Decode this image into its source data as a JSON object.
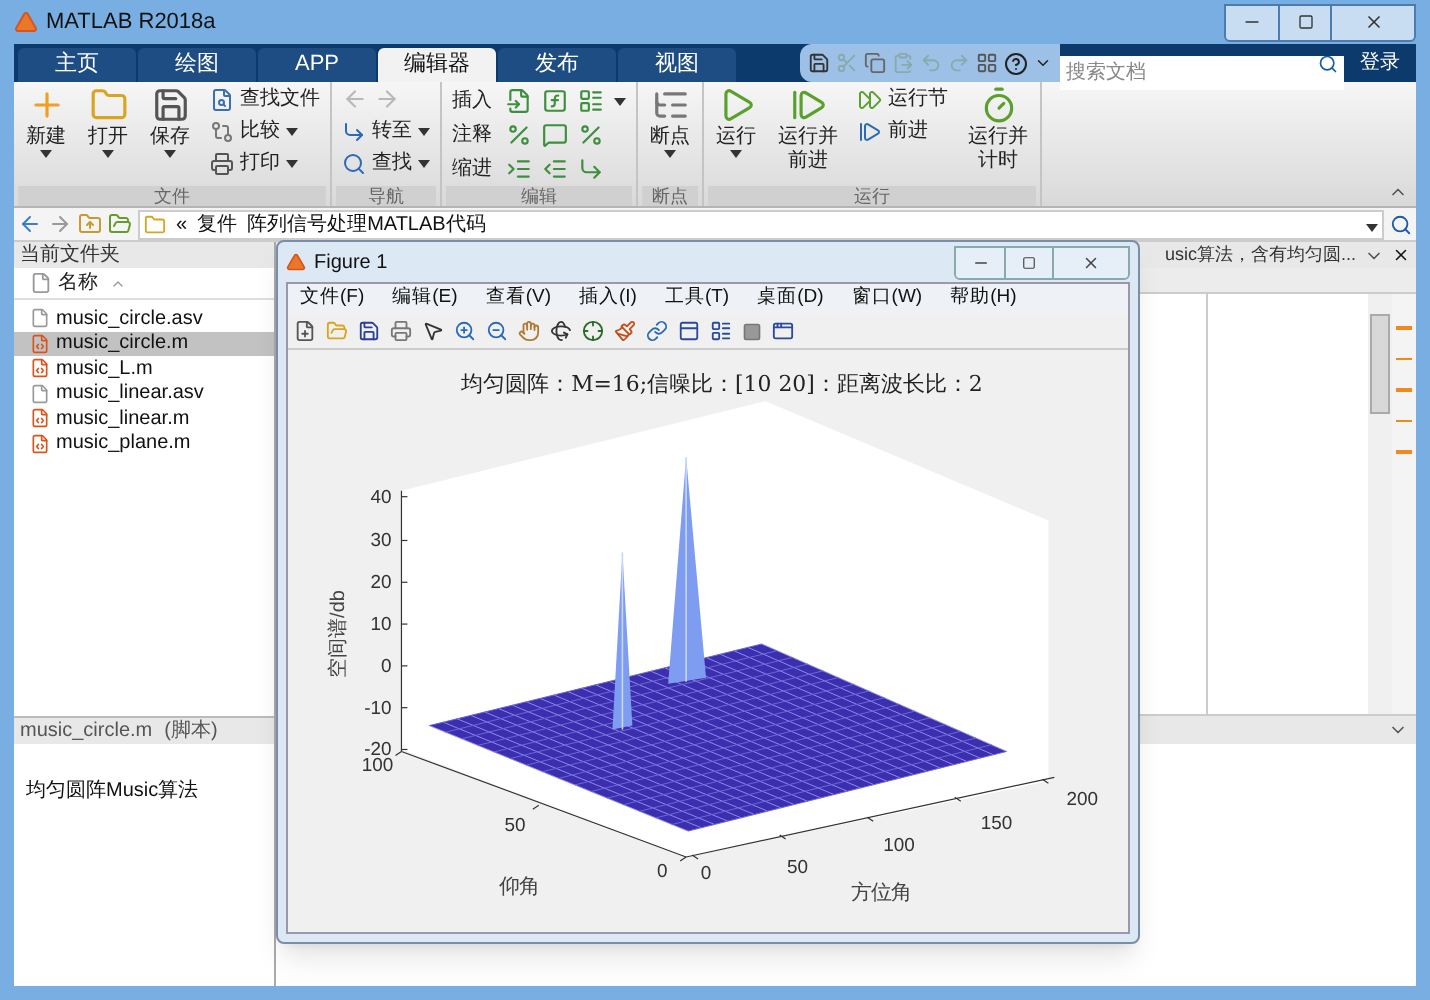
{
  "window": {
    "title": "MATLAB R2018a"
  },
  "ribbon_tabs": [
    {
      "label": "主页",
      "selected": false
    },
    {
      "label": "绘图",
      "selected": false
    },
    {
      "label": "APP",
      "selected": false
    },
    {
      "label": "编辑器",
      "selected": true
    },
    {
      "label": "发布",
      "selected": false
    },
    {
      "label": "视图",
      "selected": false
    }
  ],
  "search": {
    "placeholder": "搜索文档"
  },
  "sign_in": "登录",
  "ribbon_groups": [
    {
      "label": "文件",
      "tools": [
        {
          "kind": "large",
          "lines": [
            "新建"
          ],
          "dropdown": true
        },
        {
          "kind": "large",
          "lines": [
            "打开"
          ],
          "dropdown": true
        },
        {
          "kind": "large",
          "lines": [
            "保存"
          ],
          "dropdown": true
        },
        {
          "kind": "column",
          "items": [
            {
              "label": "查找文件",
              "dropdown": false
            },
            {
              "label": "比较",
              "dropdown": true
            },
            {
              "label": "打印",
              "dropdown": true
            }
          ]
        }
      ]
    },
    {
      "label": "导航",
      "tools": [
        {
          "kind": "column",
          "items": [
            {
              "kind": "arrows",
              "disabled": true
            },
            {
              "label": "转至",
              "dropdown": true
            },
            {
              "label": "查找",
              "dropdown": true
            }
          ]
        }
      ]
    },
    {
      "label": "编辑",
      "tools": [
        {
          "kind": "rows",
          "items": [
            {
              "label": "插入",
              "dropdown": true
            },
            {
              "label": "注释",
              "dropdown": false
            },
            {
              "label": "缩进",
              "dropdown": false
            }
          ]
        }
      ]
    },
    {
      "label": "断点",
      "tools": [
        {
          "kind": "large",
          "lines": [
            "断点"
          ],
          "dropdown": true
        }
      ]
    },
    {
      "label": "运行",
      "tools": [
        {
          "kind": "large",
          "lines": [
            "运行"
          ],
          "dropdown": true
        },
        {
          "kind": "large",
          "lines": [
            "运行并",
            "前进"
          ],
          "dropdown": false
        },
        {
          "kind": "column",
          "items": [
            {
              "label": "运行节",
              "dropdown": false
            },
            {
              "label": "前进",
              "dropdown": false
            }
          ]
        },
        {
          "kind": "large",
          "lines": [
            "运行并",
            "计时"
          ],
          "dropdown": false
        }
      ]
    }
  ],
  "address_bar": {
    "path": [
      "«",
      "复件",
      "阵列信号处理MATLAB代码"
    ]
  },
  "current_folder": {
    "title": "当前文件夹",
    "column": "名称",
    "files": [
      {
        "name": "music_circle.asv",
        "kind": "asv",
        "selected": false
      },
      {
        "name": "music_circle.m",
        "kind": "m",
        "selected": true
      },
      {
        "name": "music_L.m",
        "kind": "m",
        "selected": false
      },
      {
        "name": "music_linear.asv",
        "kind": "asv",
        "selected": false
      },
      {
        "name": "music_linear.m",
        "kind": "m",
        "selected": false
      },
      {
        "name": "music_plane.m",
        "kind": "m",
        "selected": false
      }
    ]
  },
  "details": {
    "title": "music_circle.m",
    "type": "(脚本)",
    "description": "均匀圆阵Music算法"
  },
  "editor": {
    "tab_title": "usic算法，含有均匀圆..."
  },
  "figure": {
    "title": "Figure 1",
    "menus": [
      "文件(F)",
      "编辑(E)",
      "查看(V)",
      "插入(I)",
      "工具(T)",
      "桌面(D)",
      "窗口(W)",
      "帮助(H)"
    ],
    "plot": {
      "title": "均匀圆阵：M=16;信噪比：[10 20]：距离波长比：2",
      "zlabel": "空间谱/db",
      "ylabel": "仰角",
      "xlabel": "方位角",
      "zticks": [
        "40",
        "30",
        "20",
        "10",
        "0",
        "-10",
        "-20"
      ],
      "yticks": [
        "100",
        "50",
        "0"
      ],
      "xticks": [
        "0",
        "50",
        "100",
        "150",
        "200"
      ]
    }
  }
}
